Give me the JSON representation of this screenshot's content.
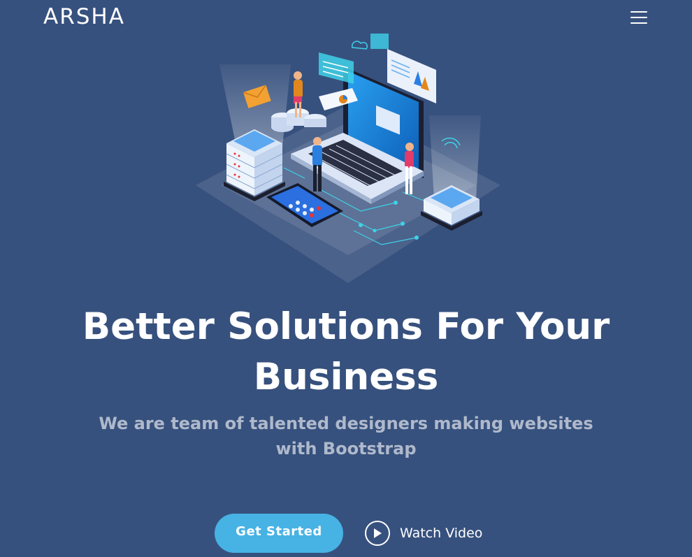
{
  "header": {
    "logo": "ARSHA",
    "menu_icon": "hamburger-menu-icon"
  },
  "hero": {
    "illustration_icon": "isometric-data-center-illustration",
    "title": "Better Solutions For Your Business",
    "subtitle": "We are team of talented designers making websites with Bootstrap",
    "cta_primary": "Get Started",
    "cta_secondary": "Watch Video",
    "cta_secondary_icon": "play-circle-icon"
  },
  "colors": {
    "background": "#37517e",
    "accent": "#47b2e4",
    "text": "#ffffff"
  }
}
